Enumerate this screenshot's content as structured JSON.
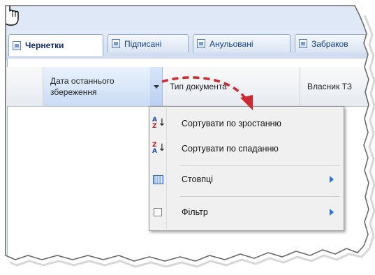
{
  "tabs": [
    {
      "label": "Чернетки",
      "active": true
    },
    {
      "label": "Підписані",
      "active": false
    },
    {
      "label": "Анульовані",
      "active": false
    },
    {
      "label": "Забраков",
      "active": false
    }
  ],
  "grid": {
    "columns": [
      {
        "label": "Дата останнього\nзбереження"
      },
      {
        "label": "Тип документа"
      },
      {
        "label": "Власник ТЗ"
      }
    ]
  },
  "menu": {
    "sort_asc": "Сортувати по зростанню",
    "sort_desc": "Сортувати по спаданню",
    "columns": "Стовпці",
    "filter": "Фільтр"
  },
  "colors": {
    "accent": "#15428b",
    "arrow": "#d0282e",
    "submenu_arrow": "#2e6fd0"
  }
}
